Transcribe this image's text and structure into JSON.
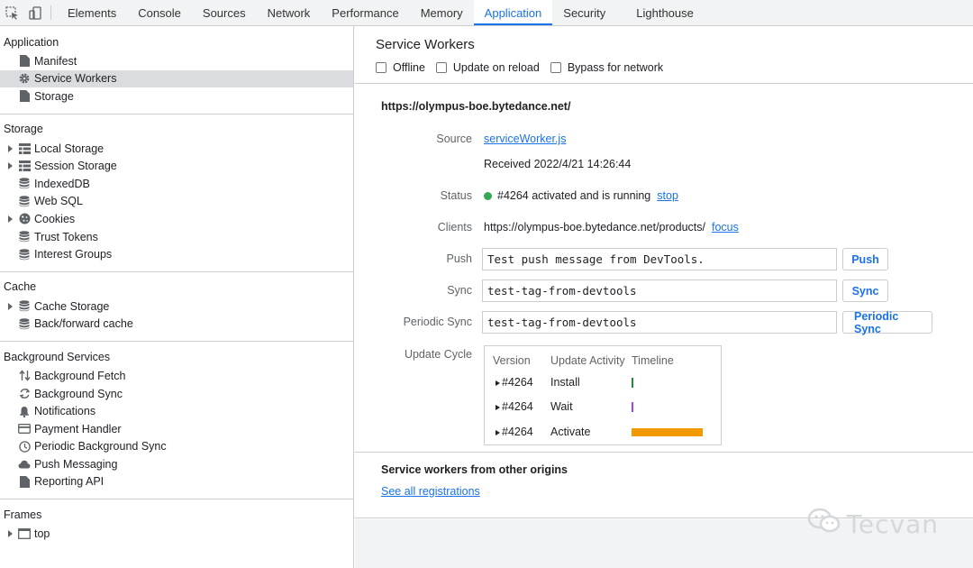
{
  "tabs": [
    {
      "label": "Elements"
    },
    {
      "label": "Console"
    },
    {
      "label": "Sources"
    },
    {
      "label": "Network"
    },
    {
      "label": "Performance"
    },
    {
      "label": "Memory"
    },
    {
      "label": "Application"
    },
    {
      "label": "Security"
    },
    {
      "label": "Lighthouse"
    }
  ],
  "active_tab": "Application",
  "sidebar": {
    "application": {
      "title": "Application",
      "items": [
        {
          "label": "Manifest",
          "icon": "file-icon"
        },
        {
          "label": "Service Workers",
          "icon": "gear-icon"
        },
        {
          "label": "Storage",
          "icon": "file-icon"
        }
      ]
    },
    "storage": {
      "title": "Storage",
      "items": [
        {
          "label": "Local Storage",
          "icon": "grid-icon"
        },
        {
          "label": "Session Storage",
          "icon": "grid-icon"
        },
        {
          "label": "IndexedDB",
          "icon": "database-icon"
        },
        {
          "label": "Web SQL",
          "icon": "database-icon"
        },
        {
          "label": "Cookies",
          "icon": "cookie-icon"
        },
        {
          "label": "Trust Tokens",
          "icon": "database-icon"
        },
        {
          "label": "Interest Groups",
          "icon": "database-icon"
        }
      ]
    },
    "cache": {
      "title": "Cache",
      "items": [
        {
          "label": "Cache Storage",
          "icon": "database-icon"
        },
        {
          "label": "Back/forward cache",
          "icon": "database-icon"
        }
      ]
    },
    "background": {
      "title": "Background Services",
      "items": [
        {
          "label": "Background Fetch",
          "icon": "arrows-updown-icon"
        },
        {
          "label": "Background Sync",
          "icon": "sync-icon"
        },
        {
          "label": "Notifications",
          "icon": "bell-icon"
        },
        {
          "label": "Payment Handler",
          "icon": "card-icon"
        },
        {
          "label": "Periodic Background Sync",
          "icon": "clock-icon"
        },
        {
          "label": "Push Messaging",
          "icon": "cloud-icon"
        },
        {
          "label": "Reporting API",
          "icon": "file-icon"
        }
      ]
    },
    "frames": {
      "title": "Frames",
      "items": [
        {
          "label": "top",
          "icon": "frame-icon"
        }
      ]
    }
  },
  "main": {
    "title": "Service Workers",
    "options": {
      "offline": "Offline",
      "update_on_reload": "Update on reload",
      "bypass": "Bypass for network"
    },
    "origin": "https://olympus-boe.bytedance.net/",
    "source_label": "Source",
    "source_link": "serviceWorker.js",
    "received": "Received 2022/4/21 14:26:44",
    "status_label": "Status",
    "status_text": "#4264 activated and is running",
    "status_link": "stop",
    "status_color": "#34a853",
    "clients_label": "Clients",
    "clients_url": "https://olympus-boe.bytedance.net/products/",
    "clients_link": "focus",
    "push_label": "Push",
    "push_value": "Test push message from DevTools.",
    "push_button": "Push",
    "sync_label": "Sync",
    "sync_value": "test-tag-from-devtools",
    "sync_button": "Sync",
    "periodic_label": "Periodic Sync",
    "periodic_value": "test-tag-from-devtools",
    "periodic_button": "Periodic Sync",
    "update_cycle_label": "Update Cycle",
    "update_cycle": {
      "headers": [
        "Version",
        "Update Activity",
        "Timeline"
      ],
      "rows": [
        {
          "version": "#4264",
          "activity": "Install",
          "timeline_color": "#1e8e3e"
        },
        {
          "version": "#4264",
          "activity": "Wait",
          "timeline_color": "#a142f4"
        },
        {
          "version": "#4264",
          "activity": "Activate",
          "timeline_color": "#f29900"
        }
      ]
    },
    "other_title": "Service workers from other origins",
    "other_link": "See all registrations"
  },
  "watermark": "Tecvan",
  "accent": "#1a73e8"
}
